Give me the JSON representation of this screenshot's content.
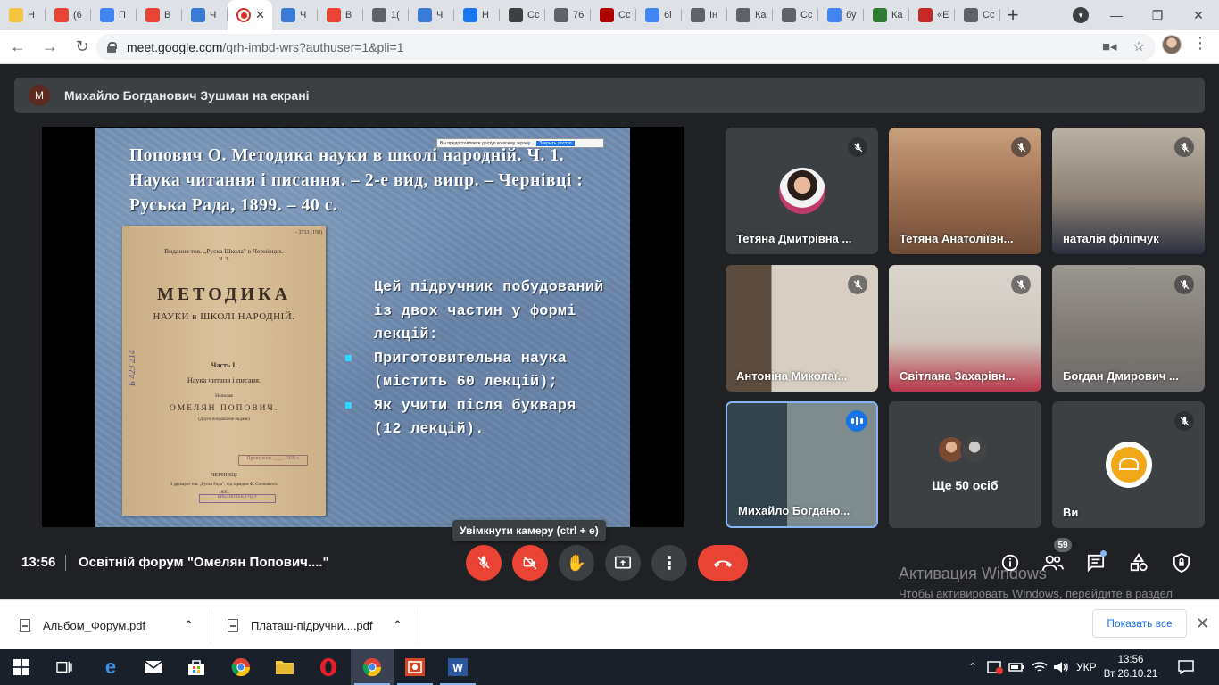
{
  "browser": {
    "tabs": [
      {
        "label": "Н",
        "icon": "sun-icon",
        "color": "#f5c542"
      },
      {
        "label": "(6",
        "icon": "gmail-icon",
        "color": "#ea4335"
      },
      {
        "label": "П",
        "icon": "docs-icon",
        "color": "#4285f4"
      },
      {
        "label": "В",
        "icon": "gmail-icon",
        "color": "#ea4335"
      },
      {
        "label": "Ч",
        "icon": "calendar-icon",
        "color": "#3a7bd5"
      },
      {
        "label": "",
        "icon": "record-icon",
        "color": "#d93025",
        "active": true
      },
      {
        "label": "Ч",
        "icon": "calendar-icon",
        "color": "#3a7bd5"
      },
      {
        "label": "В",
        "icon": "gmail-icon",
        "color": "#ea4335"
      },
      {
        "label": "1(",
        "icon": "globe-icon",
        "color": "#5f6368"
      },
      {
        "label": "Ч",
        "icon": "calendar-icon",
        "color": "#3a7bd5"
      },
      {
        "label": "Н",
        "icon": "facebook-icon",
        "color": "#1877f2"
      },
      {
        "label": "Сс",
        "icon": "library-icon",
        "color": "#3c4043"
      },
      {
        "label": "76",
        "icon": "globe-icon",
        "color": "#5f6368"
      },
      {
        "label": "Сс",
        "icon": "pkp-icon",
        "color": "#b00000"
      },
      {
        "label": "6i",
        "icon": "google-icon",
        "color": "#4285f4"
      },
      {
        "label": "Ін",
        "icon": "globe-icon",
        "color": "#5f6368"
      },
      {
        "label": "Ка",
        "icon": "globe-icon",
        "color": "#5f6368"
      },
      {
        "label": "Сс",
        "icon": "globe-icon",
        "color": "#5f6368"
      },
      {
        "label": "бу",
        "icon": "google-icon",
        "color": "#4285f4"
      },
      {
        "label": "Ка",
        "icon": "flag-icon",
        "color": "#2e7d32"
      },
      {
        "label": "«Е",
        "icon": "books-icon",
        "color": "#c62828"
      },
      {
        "label": "Сс",
        "icon": "globe-icon",
        "color": "#5f6368"
      }
    ],
    "close_glyph": "✕",
    "new_tab": "+",
    "url_host": "meet.google.com",
    "url_path": "/qrh-imbd-wrs?authuser=1&pli=1"
  },
  "meet": {
    "presenter_initial": "M",
    "presenting_text": "Михайло Богданович Зушман на екрані",
    "slide": {
      "title": "Попович О. Методика науки в школі народній. Ч. 1. Наука читання і писання. – 2-е вид, випр. – Чернівці : Руська Рада, 1899. – 40 с.",
      "share_notice": "Вы предоставляете доступ ко всему экрану.",
      "share_stop": "Закрыть доступ",
      "intro": "Цей підручник побудований із двох частин у формі лекцій:",
      "items": [
        "Приготовительна наука (містить 60 лекцій);",
        "Як учити після букваря (12 лекцій)."
      ],
      "book": {
        "num": "- 3713 (158)",
        "publisher": "Видання тов. „Руска Школа\" в Чернівцях.",
        "part": "Ч. 3.",
        "title": "МЕТОДИКА",
        "subtitle": "НАУКИ в ШКОЛІ НАРОДНІЙ.",
        "chapter": "Часть I.",
        "chapter_name": "Наука читаня і писаня.",
        "by": "Написав",
        "author": "ОМЕЛЯН ПОПОВИЧ.",
        "edition": "(Друге поправлене видане)",
        "stamp": "Проверено ____ 1958 г.",
        "city": "ЧЕРНІВЦІ",
        "print": "З друкарні тов. „Руска Рада\", під зарядом Ф. Сопошкого.",
        "year": "1899.",
        "library": "БИБЛИОТЕКА ЧДУ",
        "inventory": "Б 423 214"
      }
    },
    "participants": [
      {
        "name": "Тетяна Дмитрівна ...",
        "muted": true
      },
      {
        "name": "Тетяна Анатоліївн...",
        "muted": true
      },
      {
        "name": "наталія філіпчук",
        "muted": true
      },
      {
        "name": "Антоніна Миколаї...",
        "muted": true
      },
      {
        "name": "Світлана Захарівн...",
        "muted": true
      },
      {
        "name": "Богдан Дмирович ...",
        "muted": true
      },
      {
        "name": "Михайло Богдано...",
        "muted": false,
        "speaking": true
      },
      {
        "name": "Ще 50 осіб",
        "muted": false
      },
      {
        "name": "Ви",
        "muted": true
      }
    ],
    "tooltip": "Увімкнути камеру (ctrl + e)",
    "time": "13:56",
    "meeting_title": "Освітній форум \"Омелян Попович....\"",
    "people_count": "59",
    "accent_red": "#ea4335",
    "accent_blue": "#8ab4f8"
  },
  "windows_activation": {
    "title": "Активация Windows",
    "text": "Чтобы активировать Windows, перейдите в раздел \"Параметры\"."
  },
  "downloads": {
    "items": [
      "Альбом_Форум.pdf",
      "Платаш-підручни....pdf"
    ],
    "show_all": "Показать все",
    "close": "✕"
  },
  "taskbar": {
    "lang": "УКР",
    "time": "13:56",
    "date": "Вт 26.10.21"
  }
}
